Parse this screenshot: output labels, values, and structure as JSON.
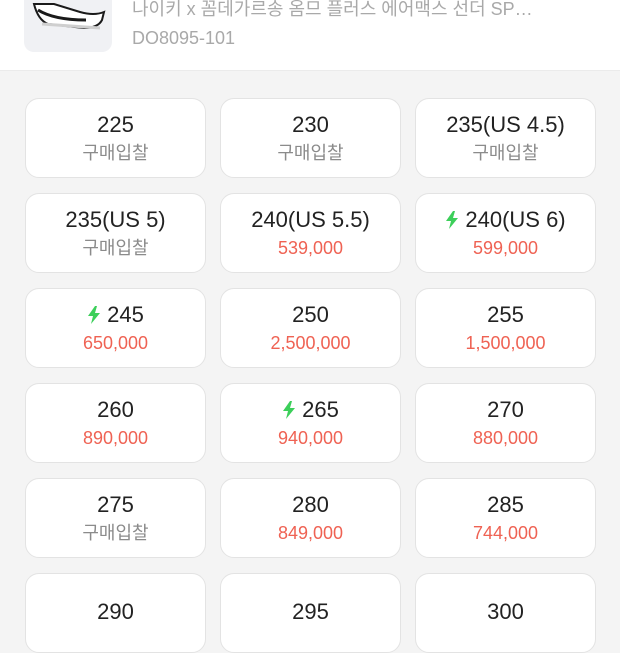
{
  "product": {
    "name": "나이키 x 꼼데가르송 옴므 플러스 에어맥스 선더 SP…",
    "code": "DO8095-101"
  },
  "colors": {
    "price": "#ef6253",
    "bolt": "#3ccf5a",
    "bid": "#8b8b8b"
  },
  "sizes": [
    {
      "size": "225",
      "sub": "구매입찰",
      "kind": "bid",
      "fast": false
    },
    {
      "size": "230",
      "sub": "구매입찰",
      "kind": "bid",
      "fast": false
    },
    {
      "size": "235(US 4.5)",
      "sub": "구매입찰",
      "kind": "bid",
      "fast": false
    },
    {
      "size": "235(US 5)",
      "sub": "구매입찰",
      "kind": "bid",
      "fast": false
    },
    {
      "size": "240(US 5.5)",
      "sub": "539,000",
      "kind": "price",
      "fast": false
    },
    {
      "size": "240(US 6)",
      "sub": "599,000",
      "kind": "price",
      "fast": true
    },
    {
      "size": "245",
      "sub": "650,000",
      "kind": "price",
      "fast": true
    },
    {
      "size": "250",
      "sub": "2,500,000",
      "kind": "price",
      "fast": false
    },
    {
      "size": "255",
      "sub": "1,500,000",
      "kind": "price",
      "fast": false
    },
    {
      "size": "260",
      "sub": "890,000",
      "kind": "price",
      "fast": false
    },
    {
      "size": "265",
      "sub": "940,000",
      "kind": "price",
      "fast": true
    },
    {
      "size": "270",
      "sub": "880,000",
      "kind": "price",
      "fast": false
    },
    {
      "size": "275",
      "sub": "구매입찰",
      "kind": "bid",
      "fast": false
    },
    {
      "size": "280",
      "sub": "849,000",
      "kind": "price",
      "fast": false
    },
    {
      "size": "285",
      "sub": "744,000",
      "kind": "price",
      "fast": false
    },
    {
      "size": "290",
      "sub": "",
      "kind": "price",
      "fast": false
    },
    {
      "size": "295",
      "sub": "",
      "kind": "price",
      "fast": false
    },
    {
      "size": "300",
      "sub": "",
      "kind": "price",
      "fast": false
    }
  ]
}
